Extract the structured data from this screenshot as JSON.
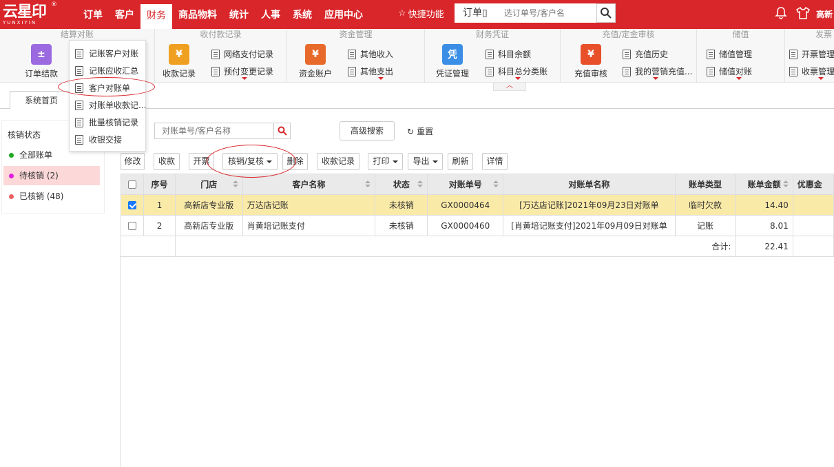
{
  "app": {
    "logo_text": "云星印",
    "logo_sub": "YUNXIYIN",
    "logo_reg": "®"
  },
  "menu": [
    "订单",
    "客户",
    "财务",
    "商品物料",
    "统计",
    "人事",
    "系统",
    "应用中心"
  ],
  "menu_active": "财务",
  "quick": {
    "label": "快捷功能",
    "select": "订单▯",
    "placeholder": "选订单号/客户名"
  },
  "user": {
    "name": "高新"
  },
  "ribbon": {
    "groups": [
      "结算对账",
      "收付款记录",
      "资金管理",
      "财务凭证",
      "充值/定金审核",
      "储值",
      "发票"
    ],
    "order_settle": "订单结款",
    "receipt_record": "收款记录",
    "net_pay": "网络支付记录",
    "prepay_change": "预付变更记录",
    "fund_account": "资金账户",
    "other_income": "其他收入",
    "other_expense": "其他支出",
    "voucher_mgmt": "凭证管理",
    "voucher_icon_text": "凭",
    "subject_balance": "科目余额",
    "subject_ledger": "科目总分类账",
    "recharge_review": "充值审核",
    "recharge_history": "充值历史",
    "my_marketing": "我的营销充值...",
    "stored_mgmt": "储值管理",
    "stored_reconcile": "储值对账",
    "invoice_mgmt": "开票管理",
    "receipt_mgmt": "收票管理"
  },
  "dropdown": [
    "记账客户对账",
    "记账应收汇总",
    "客户对账单",
    "对账单收款记...",
    "批量核销记录",
    "收银交接"
  ],
  "tab": "系统首页",
  "left": {
    "title": "核销状态",
    "items": [
      {
        "label": "全部账单",
        "color": "#22aa22"
      },
      {
        "label": "待核销 (2)",
        "color": "#e020e0"
      },
      {
        "label": "已核销 (48)",
        "color": "#f06060"
      }
    ]
  },
  "search": {
    "placeholder": "对账单号/客户名称",
    "advanced": "高级搜索",
    "reset": "重置"
  },
  "toolbar": [
    "修改",
    "收款",
    "开票",
    "核销/复核",
    "删除",
    "收款记录",
    "打印",
    "导出",
    "刷新",
    "详情"
  ],
  "table": {
    "headers": [
      "序号",
      "门店",
      "客户名称",
      "状态",
      "对账单号",
      "对账单名称",
      "账单类型",
      "账单金额",
      "优惠金"
    ],
    "rows": [
      {
        "checked": true,
        "no": "1",
        "store": "高新店专业版",
        "customer": "万达店记账",
        "status": "未核销",
        "bill_no": "GX0000464",
        "bill_name": "[万达店记账]2021年09月23日对账单",
        "type": "临时欠款",
        "amount": "14.40"
      },
      {
        "checked": false,
        "no": "2",
        "store": "高新店专业版",
        "customer": "肖黄培记账支付",
        "status": "未核销",
        "bill_no": "GX0000460",
        "bill_name": "[肖黄培记账支付]2021年09月09日对账单",
        "type": "记账",
        "amount": "8.01"
      }
    ],
    "total_label": "合计:",
    "total_value": "22.41"
  }
}
